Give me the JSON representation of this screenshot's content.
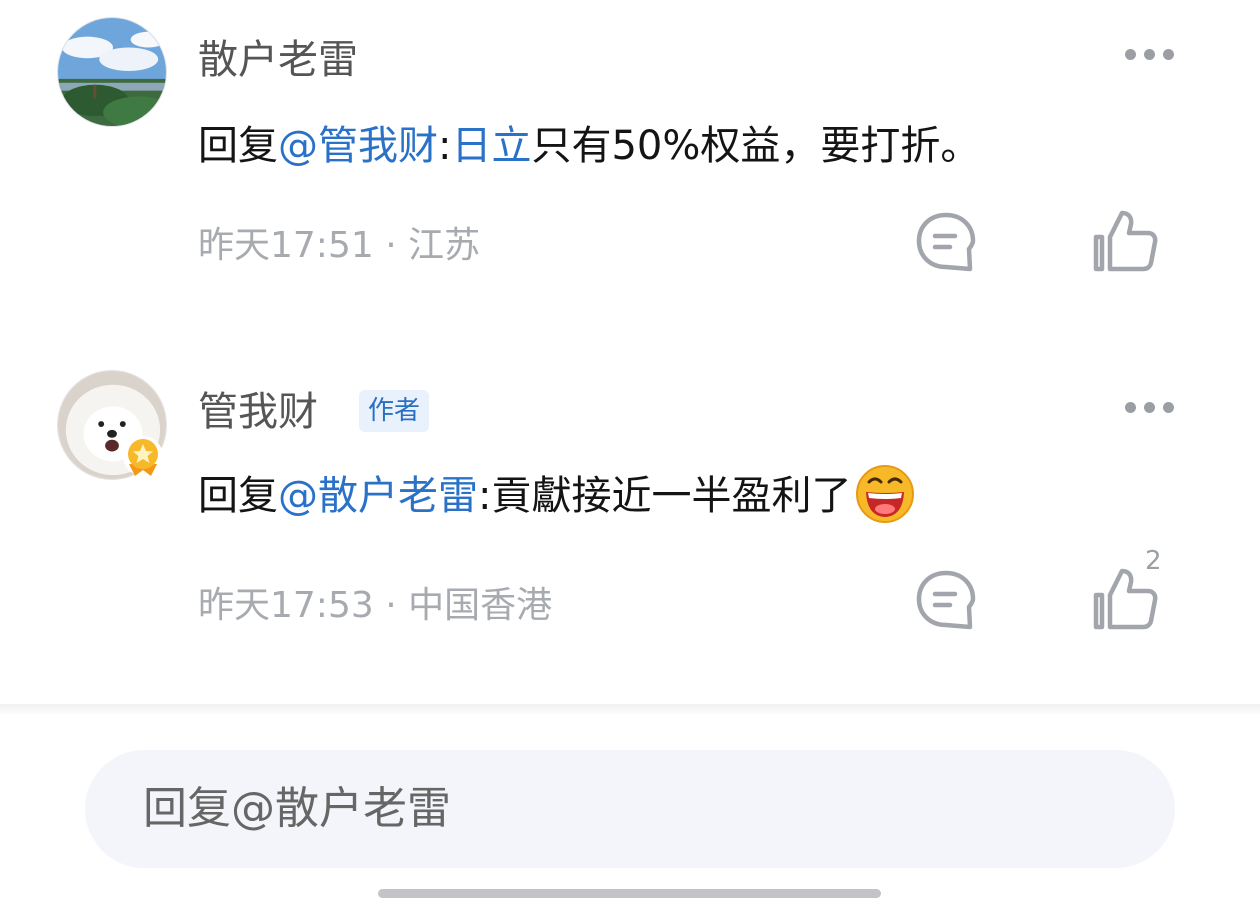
{
  "comments": [
    {
      "user": "散户老雷",
      "avatar": "landscape-avatar",
      "reply_prefix": "回复",
      "mention": "@管我财",
      "colon": ":",
      "linked_term": "日立",
      "text": "只有50%权益，要打折。",
      "time": "昨天17:51",
      "separator": "·",
      "location": "江苏",
      "likes": ""
    },
    {
      "user": "管我财",
      "author_tag": "作者",
      "avatar": "dog-avatar",
      "reply_prefix": "回复",
      "mention": "@散户老雷",
      "colon": ":",
      "text": "貢獻接近一半盈利了",
      "emoji": "laughing-emoji",
      "time": "昨天17:53",
      "separator": "·",
      "location": "中国香港",
      "likes": "2"
    }
  ],
  "reply_box": {
    "placeholder": "回复@散户老雷"
  },
  "colors": {
    "mention": "#2a72c8",
    "meta": "#a7abb0",
    "author_tag_bg": "#e8f1fc"
  }
}
